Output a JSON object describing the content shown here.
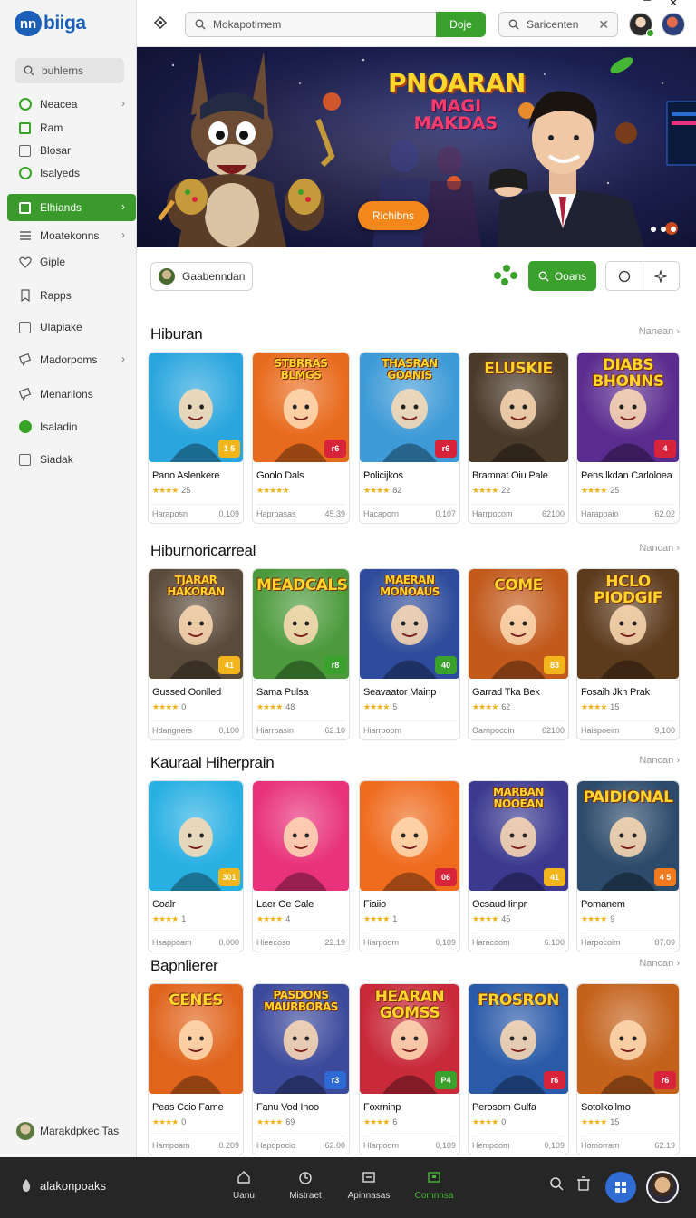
{
  "brand": {
    "logo_mark": "nn",
    "logo_text": "biiga"
  },
  "sidebar": {
    "search_label": "buhlerns",
    "items": [
      {
        "label": "Neacea",
        "icon": "ring-green-icon",
        "chevron": true
      },
      {
        "label": "Ram",
        "icon": "square-green-icon",
        "chevron": false
      },
      {
        "label": "Blosar",
        "icon": "square-gray-icon",
        "chevron": false
      },
      {
        "label": "Isalyeds",
        "icon": "ring-green-icon",
        "chevron": false
      },
      {
        "label": "Elhiands",
        "icon": "square-white-icon",
        "chevron": true,
        "active": true
      },
      {
        "label": "Moatekonns",
        "icon": "menu-icon",
        "chevron": true
      },
      {
        "label": "Giple",
        "icon": "heart-icon",
        "chevron": false
      },
      {
        "label": "Rapps",
        "icon": "bookmark-icon",
        "chevron": false
      },
      {
        "label": "Ulapiake",
        "icon": "square-gray-icon",
        "chevron": false
      },
      {
        "label": "Madorpoms",
        "icon": "chat-icon",
        "chevron": true
      },
      {
        "label": "Menarilons",
        "icon": "chat-icon",
        "chevron": false
      },
      {
        "label": "Isaladin",
        "icon": "dot-green-icon",
        "chevron": false
      },
      {
        "label": "Siadak",
        "icon": "square-gray-icon",
        "chevron": false
      }
    ],
    "footer_label": "Marakdpkec Tas"
  },
  "topbar": {
    "search_placeholder": "Mokapotimem",
    "search_button": "Doje",
    "search2_placeholder": "Saricenten",
    "close_label": "✕",
    "window_close": "✕"
  },
  "hero": {
    "title_line1": "PNOARAN",
    "title_line2": "MAGI MAKDAS",
    "button_label": "Richibns"
  },
  "filters": {
    "chip_label": "Gaabenndan",
    "green_button_label": "Ooans"
  },
  "sections": [
    {
      "title": "Hiburan",
      "more": "Nanean",
      "cards": [
        {
          "name": "Pano Aslenkere",
          "stars": "★★★★",
          "rating": "25",
          "meta_left": "Haraposn",
          "meta_right": "0,109",
          "badge": "1 5",
          "badge_color": "#f2b51b",
          "art_text": "",
          "art_bg": "#2aa6de"
        },
        {
          "name": "Goolo Dals",
          "stars": "★★★★★",
          "rating": "",
          "meta_left": "Haprpasas",
          "meta_right": "45.39",
          "badge": "r6",
          "badge_color": "#d8243a",
          "art_text": "STBRRAS BLMGS",
          "art_bg": "#e86a1c"
        },
        {
          "name": "Policijkos",
          "stars": "★★★★",
          "rating": "82",
          "meta_left": "Hacaporn",
          "meta_right": "0,107",
          "badge": "r6",
          "badge_color": "#d8243a",
          "art_text": "THASRAN GOANIS",
          "art_bg": "#3d9ad6"
        },
        {
          "name": "Bramnat Oiu Pale",
          "stars": "★★★★",
          "rating": "22",
          "meta_left": "Harrpocom",
          "meta_right": "62100",
          "badge": "",
          "badge_color": "",
          "art_text": "ELUSKIE",
          "art_bg": "#4a3a2a"
        },
        {
          "name": "Pens lkdan Carloloea",
          "stars": "★★★★",
          "rating": "25",
          "meta_left": "Harapoaio",
          "meta_right": "62.02",
          "badge": "4",
          "badge_color": "#d8243a",
          "art_text": "DIABS BHONNS",
          "art_bg": "#5b2c8f"
        }
      ]
    },
    {
      "title": "Hiburnoricarreal",
      "more": "Nancan",
      "cards": [
        {
          "name": "Gussed Oonlled",
          "stars": "★★★★",
          "rating": "0",
          "meta_left": "Hdangners",
          "meta_right": "0,100",
          "badge": "41",
          "badge_color": "#f2b51b",
          "art_text": "TJARAR HAKORAN",
          "art_bg": "#5a4a3a"
        },
        {
          "name": "Sama Pulsa",
          "stars": "★★★★",
          "rating": "48",
          "meta_left": "Hiarrpasin",
          "meta_right": "62.10",
          "badge": "r8",
          "badge_color": "#3aa12c",
          "art_text": "MEADCALS",
          "art_bg": "#4c9a3c"
        },
        {
          "name": "Seavaator Mainp",
          "stars": "★★★★",
          "rating": "5",
          "meta_left": "Hiarrpoom",
          "meta_right": "",
          "badge": "40",
          "badge_color": "#3aa12c",
          "art_text": "MAERAN MONOAUS",
          "art_bg": "#2e4c9b"
        },
        {
          "name": "Garrad Tka Bek",
          "stars": "★★★★",
          "rating": "62",
          "meta_left": "Oarnpocoin",
          "meta_right": "62100",
          "badge": "83",
          "badge_color": "#f2b51b",
          "art_text": "COME",
          "art_bg": "#c25a1c"
        },
        {
          "name": "Fosaih Jkh Prak",
          "stars": "★★★★",
          "rating": "15",
          "meta_left": "Haispoeim",
          "meta_right": "9,100",
          "badge": "",
          "badge_color": "",
          "art_text": "HCLO PIODGIF",
          "art_bg": "#5c3a1c"
        }
      ]
    },
    {
      "title": "Kauraal Hiherprain",
      "more": "Nancan",
      "cards": [
        {
          "name": "Coalr",
          "stars": "★★★★",
          "rating": "1",
          "meta_left": "Hsappoam",
          "meta_right": "0,000",
          "badge": "301",
          "badge_color": "#f2b51b",
          "art_text": "",
          "art_bg": "#29b0e3"
        },
        {
          "name": "Laer Oe Cale",
          "stars": "★★★★",
          "rating": "4",
          "meta_left": "Hieecoso",
          "meta_right": "22.19",
          "badge": "",
          "badge_color": "",
          "art_text": "",
          "art_bg": "#e8327b"
        },
        {
          "name": "Fiaiio",
          "stars": "★★★★",
          "rating": "1",
          "meta_left": "Hiarpoom",
          "meta_right": "0,109",
          "badge": "06",
          "badge_color": "#d8243a",
          "art_text": "",
          "art_bg": "#ef6c1f"
        },
        {
          "name": "Ocsaud Iinpr",
          "stars": "★★★★",
          "rating": "45",
          "meta_left": "Haracoom",
          "meta_right": "6.100",
          "badge": "41",
          "badge_color": "#f2b51b",
          "art_text": "MARBAN NOOEAN",
          "art_bg": "#3b3a8f"
        },
        {
          "name": "Pomanem",
          "stars": "★★★★",
          "rating": "9",
          "meta_left": "Harpocoim",
          "meta_right": "87.09",
          "badge": "4 5",
          "badge_color": "#f07a1c",
          "art_text": "PAIDIONAL",
          "art_bg": "#2c4a6a"
        }
      ]
    },
    {
      "title": "Bapnlierer",
      "more": "Nancan",
      "cards": [
        {
          "name": "Peas Ccio Fame",
          "stars": "★★★★",
          "rating": "0",
          "meta_left": "Hampoam",
          "meta_right": "0.209",
          "badge": "",
          "badge_color": "",
          "art_text": "CENES",
          "art_bg": "#e0641c"
        },
        {
          "name": "Fanu Vod Inoo",
          "stars": "★★★★",
          "rating": "69",
          "meta_left": "Hapopocio",
          "meta_right": "62.00",
          "badge": "r3",
          "badge_color": "#2e6ad4",
          "art_text": "PASDONS MAURBORAS",
          "art_bg": "#3c4a9c"
        },
        {
          "name": "Foxrninp",
          "stars": "★★★★",
          "rating": "6",
          "meta_left": "Hlarpoom",
          "meta_right": "0,109",
          "badge": "P4",
          "badge_color": "#3aa12c",
          "art_text": "HEARAN GOMSS",
          "art_bg": "#c82a3a"
        },
        {
          "name": "Perosom Gulfa",
          "stars": "★★★★",
          "rating": "0",
          "meta_left": "Hempoom",
          "meta_right": "0,109",
          "badge": "r6",
          "badge_color": "#d8243a",
          "art_text": "FROSRON",
          "art_bg": "#2a5aa8"
        },
        {
          "name": "Sotolkollmo",
          "stars": "★★★★",
          "rating": "15",
          "meta_left": "Homorram",
          "meta_right": "62.19",
          "badge": "r6",
          "badge_color": "#d8243a",
          "art_text": "",
          "art_bg": "#c4621c"
        }
      ]
    }
  ],
  "bottombar": {
    "brand": "alakonpoaks",
    "tabs": [
      {
        "label": "Uanu",
        "icon": "home-icon"
      },
      {
        "label": "Mistraet",
        "icon": "clock-icon"
      },
      {
        "label": "Apinnasas",
        "icon": "window-icon"
      },
      {
        "label": "Comnnsa",
        "icon": "monitor-icon",
        "active": true
      }
    ]
  },
  "colors": {
    "accent": "#3aa12c",
    "brand_blue": "#1c5fb8",
    "bottom_bar": "#262626"
  }
}
